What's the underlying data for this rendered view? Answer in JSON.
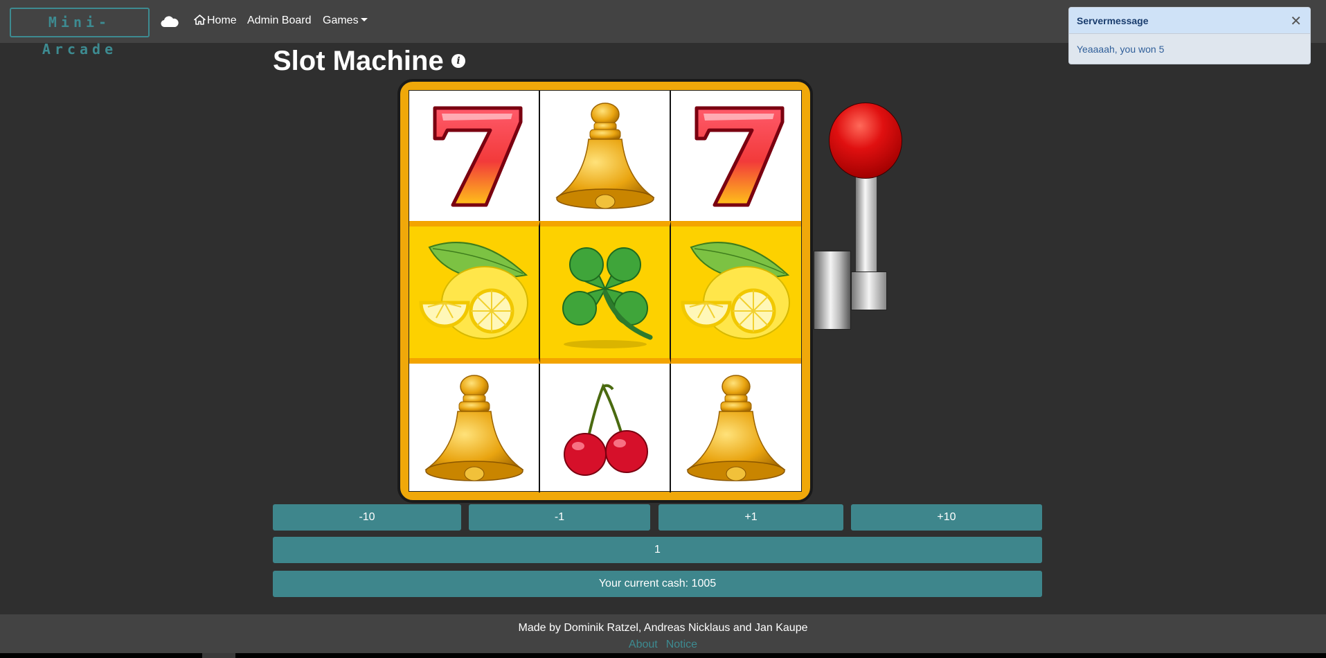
{
  "navbar": {
    "brand": "Mini-Arcade",
    "home_label": "Home",
    "admin_label": "Admin Board",
    "games_label": "Games"
  },
  "page": {
    "title": "Slot Machine"
  },
  "reels": [
    [
      "seven",
      "bell",
      "seven"
    ],
    [
      "lemon",
      "clover",
      "lemon"
    ],
    [
      "bell",
      "cherry",
      "bell"
    ]
  ],
  "controls": {
    "minus10": "-10",
    "minus1": "-1",
    "plus1": "+1",
    "plus10": "+10",
    "bet_value": "1",
    "cash_text": "Your current cash: 1005"
  },
  "footer": {
    "credits": "Made by Dominik Ratzel, Andreas Nicklaus and Jan Kaupe",
    "about": "About",
    "notice": "Notice"
  },
  "toast": {
    "title": "Servermessage",
    "message": "Yeaaaah, you won 5"
  },
  "colors": {
    "accent": "#3e868c",
    "background": "#2f2f2f",
    "navbar": "#434343",
    "machine_frame": "#f0a80a",
    "middle_row": "#fdd100"
  }
}
